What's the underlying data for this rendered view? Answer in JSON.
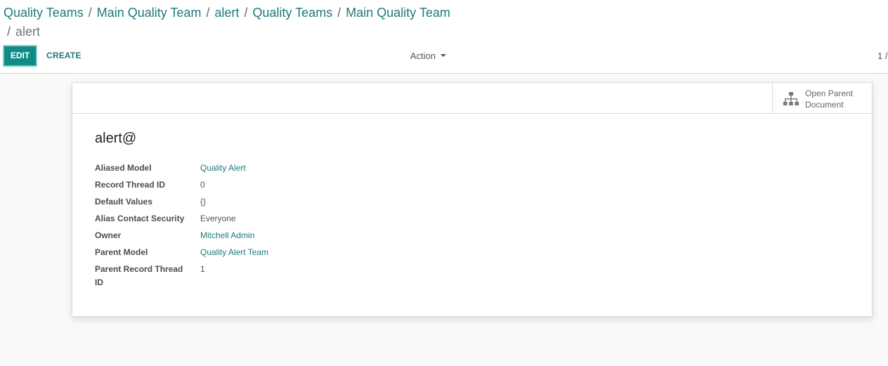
{
  "breadcrumb": {
    "items": [
      "Quality Teams",
      "Main Quality Team",
      "alert",
      "Quality Teams",
      "Main Quality Team"
    ],
    "separator": "/",
    "active": "alert"
  },
  "toolbar": {
    "edit_label": "EDIT",
    "create_label": "CREATE",
    "action_label": "Action",
    "pager": "1 /"
  },
  "smart_button": {
    "icon": "sitemap-icon",
    "line1": "Open Parent",
    "line2": "Document"
  },
  "record": {
    "title": "alert@",
    "fields": [
      {
        "label": "Aliased Model",
        "value": "Quality Alert",
        "link": true
      },
      {
        "label": "Record Thread ID",
        "value": "0",
        "link": false
      },
      {
        "label": "Default Values",
        "value": "{}",
        "link": false
      },
      {
        "label": "Alias Contact Security",
        "value": "Everyone",
        "link": false
      },
      {
        "label": "Owner",
        "value": "Mitchell Admin",
        "link": true
      },
      {
        "label": "Parent Model",
        "value": "Quality Alert Team",
        "link": true
      },
      {
        "label": "Parent Record Thread ID",
        "value": "1",
        "link": false
      }
    ]
  },
  "colors": {
    "primary": "#0e8c85",
    "link": "#1f7a7a",
    "background": "#f9f9f9"
  }
}
